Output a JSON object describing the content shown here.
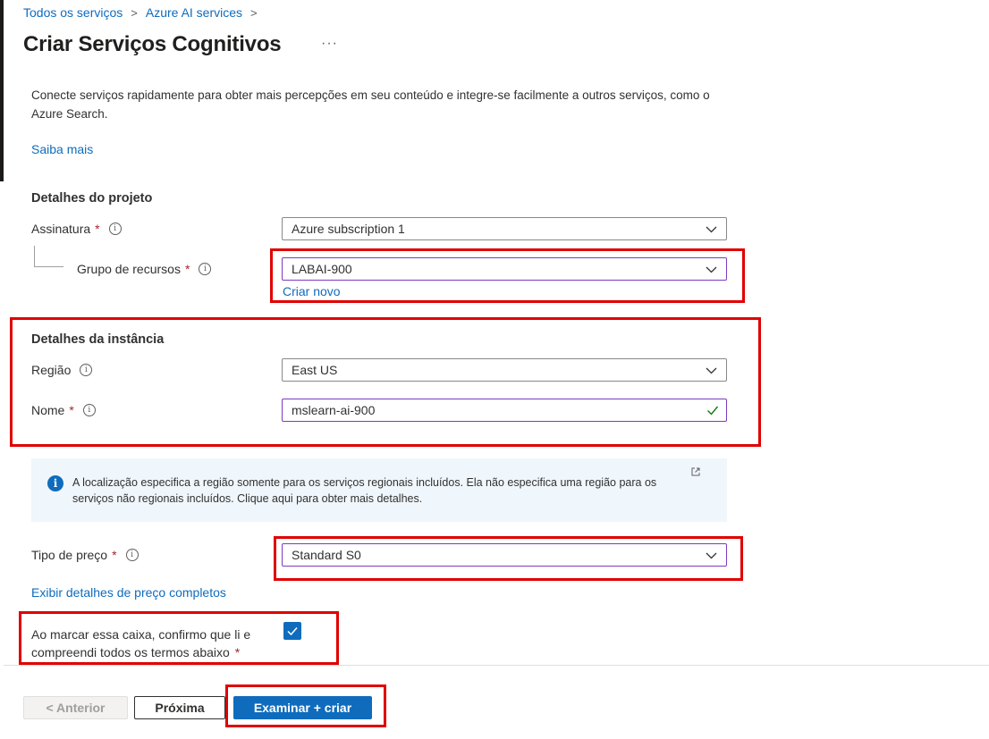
{
  "breadcrumb": [
    "Todos os serviços",
    "Azure AI services"
  ],
  "title": "Criar Serviços Cognitivos",
  "description": "Conecte serviços rapidamente para obter mais percepções em seu conteúdo e integre-se facilmente a outros serviços, como o Azure Search.",
  "learn_more": "Saiba mais",
  "project": {
    "heading": "Detalhes do projeto",
    "subscription_label": "Assinatura",
    "subscription_value": "Azure subscription 1",
    "resource_group_label": "Grupo de recursos",
    "resource_group_value": "LABAI-900",
    "create_new": "Criar novo"
  },
  "instance": {
    "heading": "Detalhes da instância",
    "region_label": "Região",
    "region_value": "East US",
    "name_label": "Nome",
    "name_value": "mslearn-ai-900"
  },
  "info_box": {
    "text": "A localização especifica a região somente para os serviços regionais incluídos. Ela não especifica uma região para os serviços não regionais incluídos. Clique aqui para obter mais detalhes."
  },
  "pricing": {
    "label": "Tipo de preço",
    "value": "Standard S0",
    "details_link": "Exibir detalhes de preço completos"
  },
  "terms": {
    "text": "Ao marcar essa caixa, confirmo que li e compreendi todos os termos abaixo",
    "required_mark": "*",
    "checked": true
  },
  "footer": {
    "prev": "< Anterior",
    "next": "Próxima",
    "create": "Examinar + criar"
  },
  "required_mark": "*",
  "info_glyph": "i",
  "colors": {
    "accent": "#0f6cbd",
    "highlight_box": "#e00000",
    "required": "#a4262c",
    "valid_check": "#107c10"
  }
}
